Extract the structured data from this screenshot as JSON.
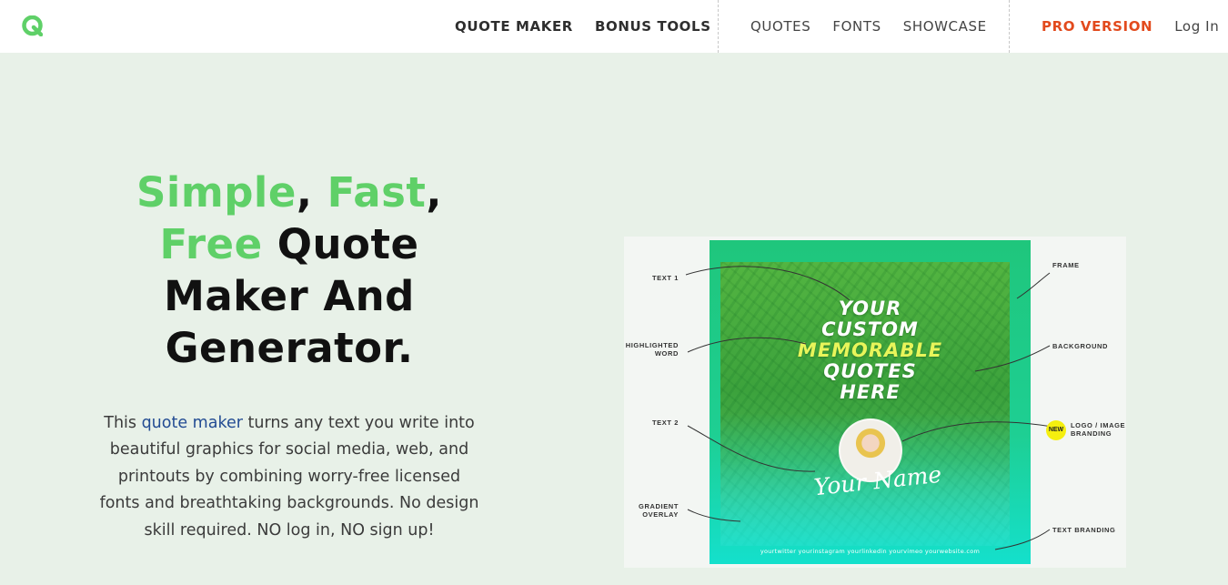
{
  "header": {
    "logo_letter": "Q",
    "nav_main": [
      "QUOTE MAKER",
      "BONUS TOOLS"
    ],
    "nav_secondary": [
      "QUOTES",
      "FONTS",
      "SHOWCASE"
    ],
    "pro_label": "PRO VERSION",
    "login_label": "Log In"
  },
  "colors": {
    "accent_green": "#5fd068",
    "pro_orange": "#e24a1d",
    "link_blue": "#234c93",
    "background": "#e8f1e8"
  },
  "hero": {
    "title_simple": "Simple",
    "title_comma1": ", ",
    "title_fast": "Fast",
    "title_comma2": ",",
    "title_free": "Free",
    "title_quote": " Quote",
    "title_line3": "Maker And",
    "title_line4": "Generator.",
    "desc_before": "This ",
    "desc_link": "quote maker",
    "desc_after": " turns any text you write into beautiful graphics for social media, web, and printouts by combining worry-free licensed fonts and breathtaking backgrounds. No design skill required. NO log in, NO sign up!"
  },
  "illustration": {
    "quote_lines": [
      "YOUR",
      "CUSTOM",
      "MEMORABLE",
      "QUOTES",
      "HERE"
    ],
    "signature": "Your Name",
    "branding_bar": "yourtwitter   yourinstagram   yourlinkedin   yourvimeo   yourwebsite.com",
    "labels": {
      "text1": "TEXT 1",
      "highlighted_1": "HIGHLIGHTED",
      "highlighted_2": "WORD",
      "text2": "TEXT 2",
      "gradient_1": "GRADIENT",
      "gradient_2": "OVERLAY",
      "frame": "FRAME",
      "background": "BACKGROUND",
      "logo_1": "LOGO / IMAGE",
      "logo_2": "BRANDING",
      "text_branding": "TEXT BRANDING",
      "new_badge": "NEW"
    }
  }
}
